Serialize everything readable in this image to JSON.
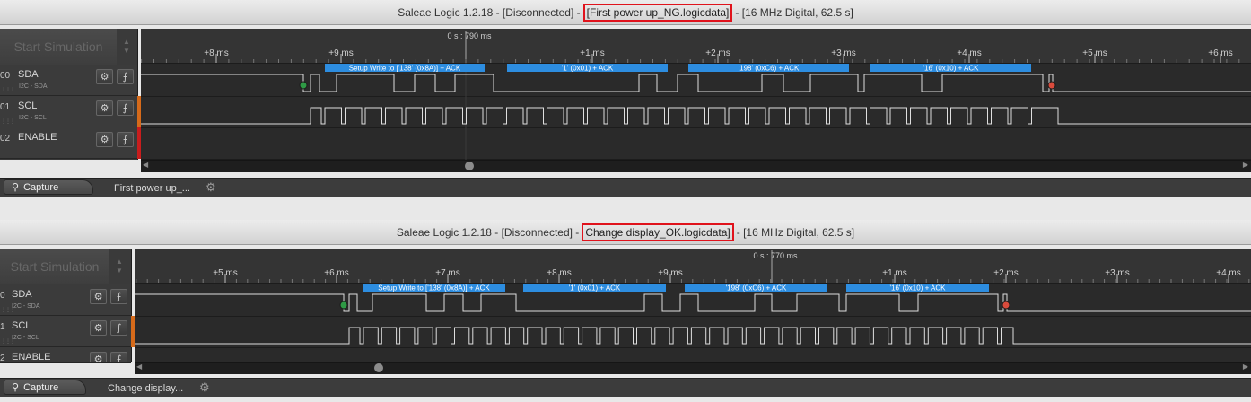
{
  "windows": [
    {
      "title_prefix": "Saleae Logic 1.2.18 - [Disconnected] -",
      "title_file": "[First power up_NG.logicdata]",
      "title_suffix": "- [16 MHz Digital, 62.5 s]",
      "start_simulation": "Start Simulation",
      "cursor_time": "0 s : 790 ms",
      "ticks": [
        "+8 ms",
        "+9 ms",
        "+1 ms",
        "+2 ms",
        "+3 ms",
        "+4 ms",
        "+5 ms",
        "+6 ms"
      ],
      "channels": [
        {
          "num": "00",
          "name": "SDA",
          "sub": "I2C - SDA"
        },
        {
          "num": "01",
          "name": "SCL",
          "sub": "I2C - SCL"
        },
        {
          "num": "02",
          "name": "ENABLE",
          "sub": ""
        }
      ],
      "decodes": [
        "Setup Write to ['138' (0x8A)] + ACK",
        "'1' (0x01) + ACK",
        "'198' (0xC6) + ACK",
        "'16' (0x10) + ACK"
      ],
      "tabs": {
        "capture": "Capture",
        "file": "First power up_..."
      }
    },
    {
      "title_prefix": "Saleae Logic 1.2.18 - [Disconnected] -",
      "title_file": "Change display_OK.logicdata]",
      "title_suffix": "- [16 MHz Digital, 62.5 s]",
      "start_simulation": "Start Simulation",
      "cursor_time": "0 s : 770 ms",
      "ticks": [
        "+5 ms",
        "+6 ms",
        "+7 ms",
        "+8 ms",
        "+9 ms",
        "+1 ms",
        "+2 ms",
        "+3 ms",
        "+4 ms"
      ],
      "channels": [
        {
          "num": "0",
          "name": "SDA",
          "sub": "I2C - SDA"
        },
        {
          "num": "1",
          "name": "SCL",
          "sub": "I2C - SCL"
        },
        {
          "num": "2",
          "name": "ENABLE",
          "sub": ""
        }
      ],
      "decodes": [
        "Setup Write to ['138' (0x8A)] + ACK",
        "'1' (0x01) + ACK",
        "'198' (0xC6) + ACK",
        "'16' (0x10) + ACK"
      ],
      "tabs": {
        "capture": "Capture",
        "file": "Change display..."
      }
    }
  ],
  "colors": {
    "decode": "#2d8de0",
    "start_marker": "#2f9a45",
    "stop_marker": "#d94b3c",
    "scl_channel": "#d66a1a",
    "enable_channel": "#c81d1d",
    "highlight": "#e0131c"
  },
  "icons": {
    "gear": "gear-icon",
    "trigger": "trigger-icon",
    "search": "search-icon"
  }
}
